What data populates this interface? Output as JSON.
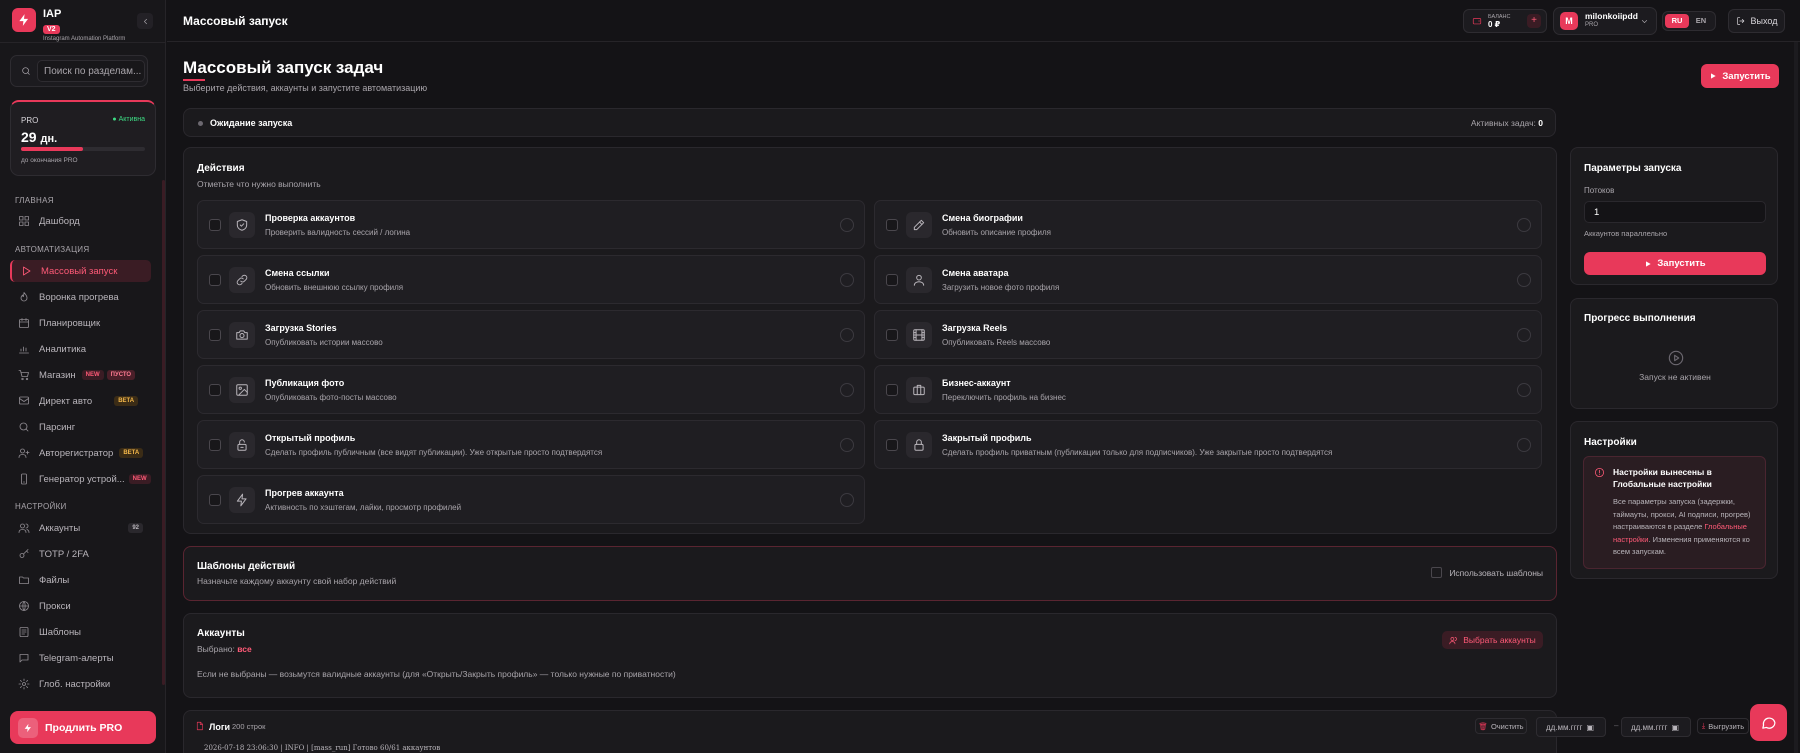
{
  "app": {
    "name": "IAP",
    "version": "V2",
    "subtitle": "Instagram Automation Platform"
  },
  "colors": {
    "accent": "#e8395a",
    "success": "#3ddc84",
    "warning": "#f5b84a",
    "background": "#141316"
  },
  "sidebar": {
    "search_placeholder": "Поиск по разделам...",
    "pro": {
      "plan": "PRO",
      "status": "Активна",
      "days": "29",
      "days_unit": "дн.",
      "days_progress_fraction": 0.5,
      "until": "до окончания PRO"
    },
    "sections": {
      "main": "ГЛАВНАЯ",
      "automation": "АВТОМАТИЗАЦИЯ",
      "settings": "НАСТРОЙКИ"
    },
    "items": [
      {
        "label": "Дашборд",
        "icon": "grid-icon"
      },
      {
        "label": "Массовый запуск",
        "icon": "play-icon",
        "active": true
      },
      {
        "label": "Воронка прогрева",
        "icon": "flame-icon"
      },
      {
        "label": "Планировщик",
        "icon": "calendar-icon"
      },
      {
        "label": "Аналитика",
        "icon": "chart-icon"
      },
      {
        "label": "Магазин",
        "icon": "cart-icon",
        "badge": "NEW",
        "badge2": "ПУСТО"
      },
      {
        "label": "Директ авто",
        "icon": "message-icon",
        "badge": "BETA"
      },
      {
        "label": "Парсинг",
        "icon": "search-icon"
      },
      {
        "label": "Авторегистратор",
        "icon": "user-plus-icon",
        "badge": "BETA"
      },
      {
        "label": "Генератор устрой...",
        "icon": "device-icon",
        "badge": "NEW"
      },
      {
        "label": "Аккаунты",
        "icon": "users-icon",
        "count": "92"
      },
      {
        "label": "TOTP / 2FA",
        "icon": "key-icon"
      },
      {
        "label": "Файлы",
        "icon": "folder-icon"
      },
      {
        "label": "Прокси",
        "icon": "globe-icon"
      },
      {
        "label": "Шаблоны",
        "icon": "template-icon"
      },
      {
        "label": "Telegram-алерты",
        "icon": "bell-icon"
      },
      {
        "label": "Глоб. настройки",
        "icon": "gear-icon"
      }
    ],
    "extend_label": "Продлить PRO"
  },
  "topbar": {
    "title": "Массовый запуск",
    "balance_label": "БАЛАНС",
    "balance_value": "0 ₽",
    "balance_add": "+",
    "user_initial": "M",
    "user_name": "milonkoiipdd",
    "user_plan": "PRO",
    "lang_ru": "RU",
    "lang_en": "EN",
    "logout": "Выход"
  },
  "page": {
    "title": "Массовый запуск задач",
    "subtitle": "Выберите действия, аккаунты и запустите автоматизацию",
    "run_button": "Запустить",
    "status": "Ожидание запуска",
    "active_tasks_label": "Активных задач:",
    "active_tasks_value": "0"
  },
  "actions": {
    "title": "Действия",
    "subtitle": "Отметьте что нужно выполнить",
    "items": [
      {
        "title": "Проверка аккаунтов",
        "desc": "Проверить валидность сессий / логина",
        "icon": "shield-check-icon"
      },
      {
        "title": "Смена биографии",
        "desc": "Обновить описание профиля",
        "icon": "edit-icon"
      },
      {
        "title": "Смена ссылки",
        "desc": "Обновить внешнюю ссылку профиля",
        "icon": "link-icon"
      },
      {
        "title": "Смена аватара",
        "desc": "Загрузить новое фото профиля",
        "icon": "user-icon"
      },
      {
        "title": "Загрузка Stories",
        "desc": "Опубликовать истории массово",
        "icon": "camera-icon"
      },
      {
        "title": "Загрузка Reels",
        "desc": "Опубликовать Reels массово",
        "icon": "film-icon"
      },
      {
        "title": "Публикация фото",
        "desc": "Опубликовать фото-посты массово",
        "icon": "image-icon"
      },
      {
        "title": "Бизнес-аккаунт",
        "desc": "Переключить профиль на бизнес",
        "icon": "briefcase-icon"
      },
      {
        "title": "Открытый профиль",
        "desc": "Сделать профиль публичным (все видят публикации). Уже открытые просто подтвердятся",
        "icon": "unlock-icon"
      },
      {
        "title": "Закрытый профиль",
        "desc": "Сделать профиль приватным (публикации только для подписчиков). Уже закрытые просто подтвердятся",
        "icon": "lock-icon"
      },
      {
        "title": "Прогрев аккаунта",
        "desc": "Активность по хэштегам, лайки, просмотр профилей",
        "icon": "bolt-icon"
      }
    ]
  },
  "templates": {
    "title": "Шаблоны действий",
    "subtitle": "Назначьте каждому аккаунту свой набор действий",
    "checkbox_label": "Использовать шаблоны"
  },
  "accounts": {
    "title": "Аккаунты",
    "selected_label": "Выбрано:",
    "selected_value": "все",
    "pick_button": "Выбрать аккаунты",
    "note": "Если не выбраны — возьмутся валидные аккаунты (для «Открыть/Закрыть профиль» — только нужные по приватности)"
  },
  "logs": {
    "title": "Логи",
    "count": "200 строк",
    "clear": "Очистить",
    "date_placeholder": "дд.мм.гггг",
    "date_sep": "–",
    "export": "Выгрузить",
    "line": "2026-07-18 23:06:30 | INFO    | [mass_run] Готово 60/61 аккаунтов"
  },
  "params": {
    "title": "Параметры запуска",
    "threads_label": "Потоков",
    "threads_value": "1",
    "threads_hint": "Аккаунтов параллельно",
    "run_button": "Запустить"
  },
  "progress": {
    "title": "Прогресс выполнения",
    "message": "Запуск не активен"
  },
  "settings": {
    "title": "Настройки",
    "alert_title": "Настройки вынесены в Глобальные настройки",
    "alert_body_1": "Все параметры запуска (задержки, таймауты, прокси, AI подписи, прогрев) настраиваются в разделе ",
    "alert_link": "Глобальные настройки",
    "alert_body_2": ". Изменения применяются ко всем запускам."
  }
}
